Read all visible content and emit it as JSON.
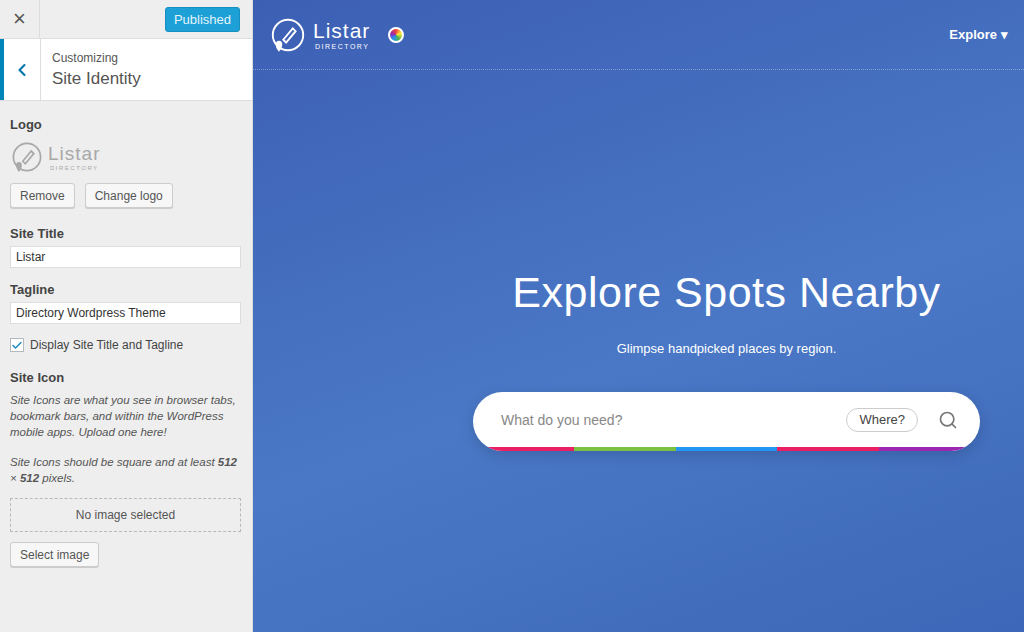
{
  "topbar": {
    "close": "×",
    "publish_button": "Published"
  },
  "section": {
    "subtitle": "Customizing",
    "title": "Site Identity"
  },
  "logo_control": {
    "label": "Logo",
    "preview": {
      "name": "Listar",
      "tagline": "DIRECTORY"
    },
    "buttons": [
      "Remove",
      "Change logo"
    ]
  },
  "fields": [
    {
      "kind": "text",
      "label": "Site Title",
      "value": "Listar"
    },
    {
      "kind": "text",
      "label": "Tagline",
      "value": "Directory Wordpress Theme"
    },
    {
      "kind": "checkbox",
      "label": "Display Site Title and Tagline",
      "checked": true
    }
  ],
  "site_icon": {
    "label": "Site Icon",
    "description": "Site Icons are what you see in browser tabs, bookmark bars, and within the WordPress mobile apps. Upload one here!",
    "size_note": [
      {
        "text": "Site Icons should be square and at least ",
        "bold": false
      },
      {
        "text": "512",
        "bold": true
      },
      {
        "text": " × ",
        "bold": false
      },
      {
        "text": "512",
        "bold": true
      },
      {
        "text": " pixels.",
        "bold": false
      }
    ],
    "placeholder": "No image selected",
    "button": "Select image"
  },
  "preview": {
    "logo": {
      "name": "Listar",
      "tagline": "DIRECTORY"
    },
    "menu": {
      "label": "Explore",
      "arrow": "▾"
    },
    "hero": {
      "title": "Explore Spots Nearby",
      "subtitle": "Glimpse handpicked places by region."
    },
    "search": {
      "placeholder": "What do you need?",
      "where_button": "Where?",
      "accents": [
        {
          "color": "#e91e63"
        },
        {
          "color": "#7ac143"
        },
        {
          "color": "#2196f3"
        },
        {
          "color": "#e91e63"
        },
        {
          "color": "#9c27b0"
        }
      ]
    }
  }
}
